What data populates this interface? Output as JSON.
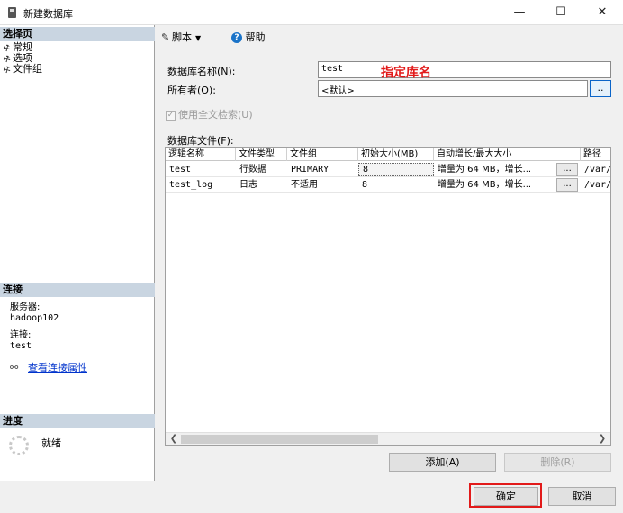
{
  "window": {
    "title": "新建数据库",
    "minimize": "—",
    "maximize": "☐",
    "close": "✕"
  },
  "left": {
    "select_page_header": "选择页",
    "pages": [
      {
        "label": "常规"
      },
      {
        "label": "选项"
      },
      {
        "label": "文件组"
      }
    ],
    "connection_header": "连接",
    "server_label": "服务器:",
    "server_value": "hadoop102",
    "connection_label": "连接:",
    "connection_value": "test",
    "view_connection_link": "查看连接属性",
    "progress_header": "进度",
    "progress_status": "就绪"
  },
  "toolbar": {
    "script_label": "脚本",
    "help_label": "帮助"
  },
  "form": {
    "dbname_label": "数据库名称(N):",
    "dbname_value": "test",
    "annotation": "指定库名",
    "owner_label": "所有者(O):",
    "owner_value": "<默认>",
    "owner_browse": "..",
    "fulltext_label": "使用全文检索(U)",
    "files_label": "数据库文件(F):"
  },
  "grid": {
    "columns": [
      "逻辑名称",
      "文件类型",
      "文件组",
      "初始大小(MB)",
      "自动增长/最大大小",
      "",
      "路径"
    ],
    "rows": [
      {
        "logical": "test",
        "type": "行数据",
        "filegroup": "PRIMARY",
        "size": "8",
        "growth": "增量为 64 MB，增长...",
        "browse": "...",
        "path": "/var/"
      },
      {
        "logical": "test_log",
        "type": "日志",
        "filegroup": "不适用",
        "size": "8",
        "growth": "增量为 64 MB，增长...",
        "browse": "...",
        "path": "/var/"
      }
    ]
  },
  "buttons": {
    "add": "添加(A)",
    "remove": "删除(R)",
    "ok": "确定",
    "cancel": "取消"
  },
  "colors": {
    "annotation": "#e21a1a",
    "section_header_bg": "#c9d5e1",
    "link": "#0033cc"
  }
}
